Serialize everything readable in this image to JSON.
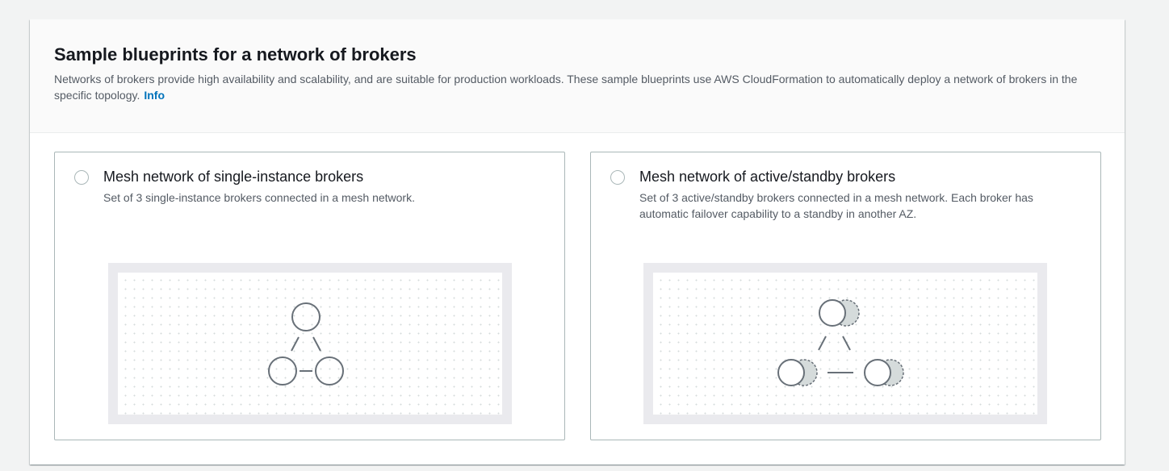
{
  "section": {
    "title": "Sample blueprints for a network of brokers",
    "description": "Networks of brokers provide high availability and scalability, and are suitable for production workloads. These sample blueprints use AWS CloudFormation to automatically deploy a network of brokers in the specific topology.",
    "info_link": "Info"
  },
  "options": [
    {
      "title": "Mesh network of single-instance brokers",
      "description": "Set of 3 single-instance brokers connected in a mesh network.",
      "selected": false,
      "diagram_icon": "mesh-single-instance-diagram"
    },
    {
      "title": "Mesh network of active/standby brokers",
      "description": "Set of 3 active/standby brokers connected in a mesh network. Each broker has automatic failover capability to a standby in another AZ.",
      "selected": false,
      "diagram_icon": "mesh-active-standby-diagram"
    }
  ],
  "colors": {
    "link": "#0073bb",
    "node_stroke": "#687078",
    "standby_fill": "#d5dbdb"
  }
}
